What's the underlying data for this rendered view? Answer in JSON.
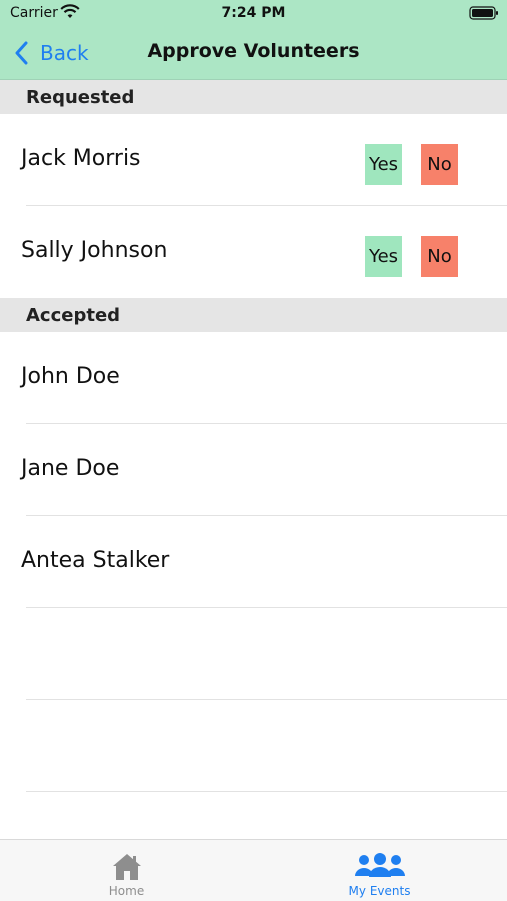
{
  "status_bar": {
    "carrier": "Carrier",
    "time": "7:24 PM"
  },
  "nav": {
    "back_label": "Back",
    "title": "Approve Volunteers"
  },
  "colors": {
    "header_bg": "#ace6c5",
    "accent_blue": "#1f7ff0",
    "yes_button": "#9fe6be",
    "no_button": "#f7816a",
    "inactive_tab": "#8e8e8e"
  },
  "sections": {
    "requested": {
      "label": "Requested",
      "items": [
        {
          "name": "Jack Morris",
          "yes_label": "Yes",
          "no_label": "No"
        },
        {
          "name": "Sally Johnson",
          "yes_label": "Yes",
          "no_label": "No"
        }
      ]
    },
    "accepted": {
      "label": "Accepted",
      "items": [
        {
          "name": "John Doe"
        },
        {
          "name": "Jane Doe"
        },
        {
          "name": "Antea Stalker"
        }
      ]
    }
  },
  "tabs": [
    {
      "label": "Home",
      "icon": "home-icon",
      "active": false
    },
    {
      "label": "My Events",
      "icon": "people-icon",
      "active": true
    }
  ]
}
